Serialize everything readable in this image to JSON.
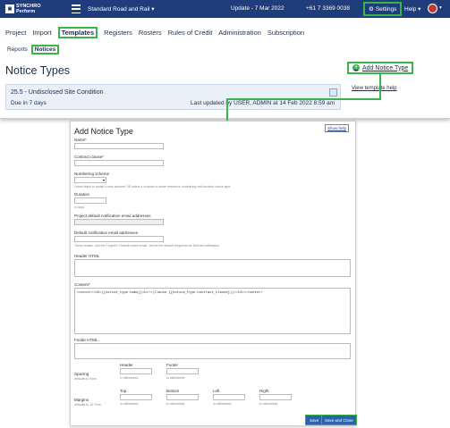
{
  "topbar": {
    "logo_line1": "SYNCHRO",
    "logo_line2": "Perform",
    "project": "Standard Road and Rail",
    "update": "Update - 7 Mar 2022",
    "phone": "+61 7 3369 0038",
    "settings": "Settings",
    "help": "Help"
  },
  "nav": {
    "items": [
      "Project",
      "Import",
      "Templates",
      "Registers",
      "Rosters",
      "Rules of Credit",
      "Administration",
      "Subscription"
    ]
  },
  "subnav": {
    "items": [
      "Reports",
      "Notices"
    ]
  },
  "page": {
    "title": "Notice Types",
    "add_button": "Add Notice Type",
    "view_help": "View template help"
  },
  "notice": {
    "title": "25.5 - Undisclosed Site Condition",
    "due": "Due in 7 days",
    "updated": "Last updated by USER, ADMIN at 14 Feb 2022 8:59 am"
  },
  "colors": {
    "topbar": "#1f3d7a",
    "highlight": "#3ab54a",
    "button": "#2b63a8"
  },
  "form": {
    "title": "Add Notice Type",
    "show_help": "Show help",
    "name_label": "Name*",
    "contract_clause_label": "Contract clause*",
    "numbering_label": "Numbering scheme",
    "numbering_hint": "Leave blank to create a new scheme OR select a scheme to share reference numbering with another notice type.",
    "duration_label": "Duration",
    "duration_hint": "in days",
    "project_email_label": "Project default notification email addresses",
    "default_email_label": "Default notification email addresses",
    "email_hint": "These emails, and the Project's 'Default notice email', will be the default recipients for Notices notification.",
    "header_html_label": "Header HTML",
    "content_label": "Content*",
    "content_value": "<center><h3>{{notice_type.name}}<br/>(Clause {{notice_type.contract_clause}})</h3></center>",
    "footer_html_label": "Footer HTML",
    "spacing_label": "Spacing",
    "spacing_hint": "defaults to 0mm",
    "spacing_header": "Header",
    "spacing_footer": "Footer",
    "margins_label": "Margins",
    "margins_hint": "defaults to 12.7mm",
    "margin_top": "Top",
    "margin_bottom": "Bottom",
    "margin_left": "Left",
    "margin_right": "Right",
    "unit_hint": "in millimetres",
    "save": "Save",
    "save_close": "Save and Close"
  }
}
